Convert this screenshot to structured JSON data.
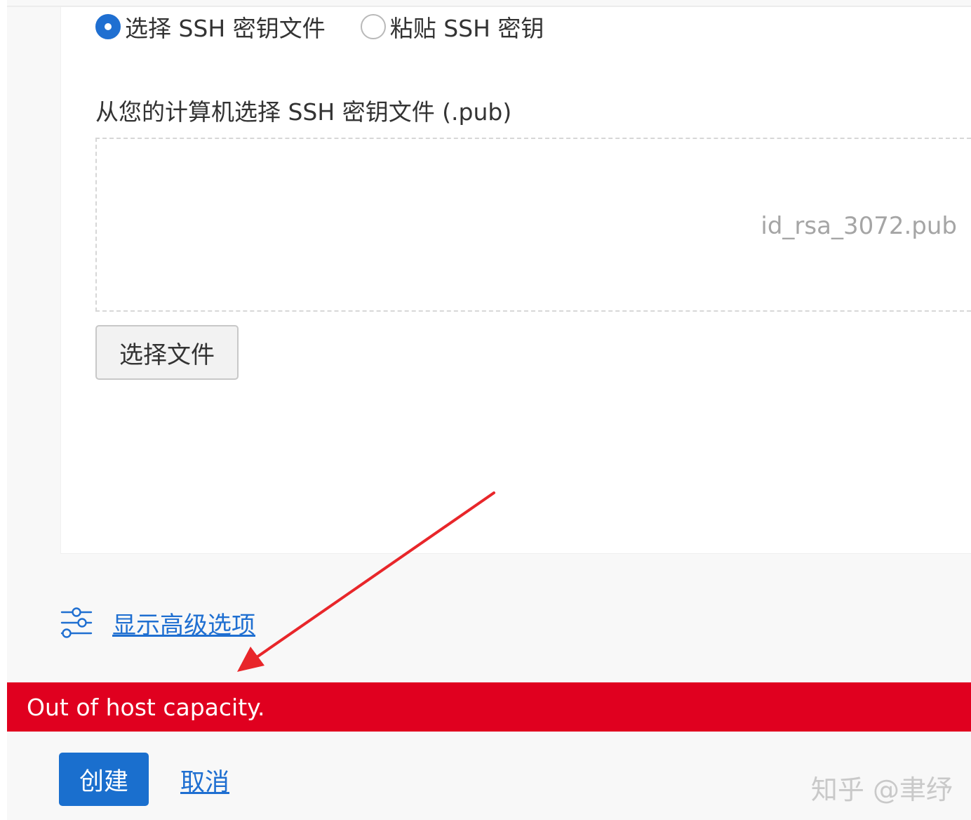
{
  "ssh_key": {
    "options": [
      {
        "label": "选择 SSH 密钥文件",
        "selected": true
      },
      {
        "label": "粘贴 SSH 密钥",
        "selected": false
      }
    ],
    "file_label": "从您的计算机选择 SSH 密钥文件 (.pub)",
    "selected_file": "id_rsa_3072.pub",
    "choose_file_button": "选择文件"
  },
  "advanced": {
    "icon": "sliders-icon",
    "link_label": "显示高级选项"
  },
  "error": {
    "message": "Out of host capacity.",
    "color": "#e0001f"
  },
  "annotation": {
    "arrow_color": "#e8262a"
  },
  "actions": {
    "create_label": "创建",
    "cancel_label": "取消"
  },
  "watermark": "知乎 @聿纾",
  "colors": {
    "accent": "#1f6fd1",
    "primary_button": "#1a6fce"
  }
}
